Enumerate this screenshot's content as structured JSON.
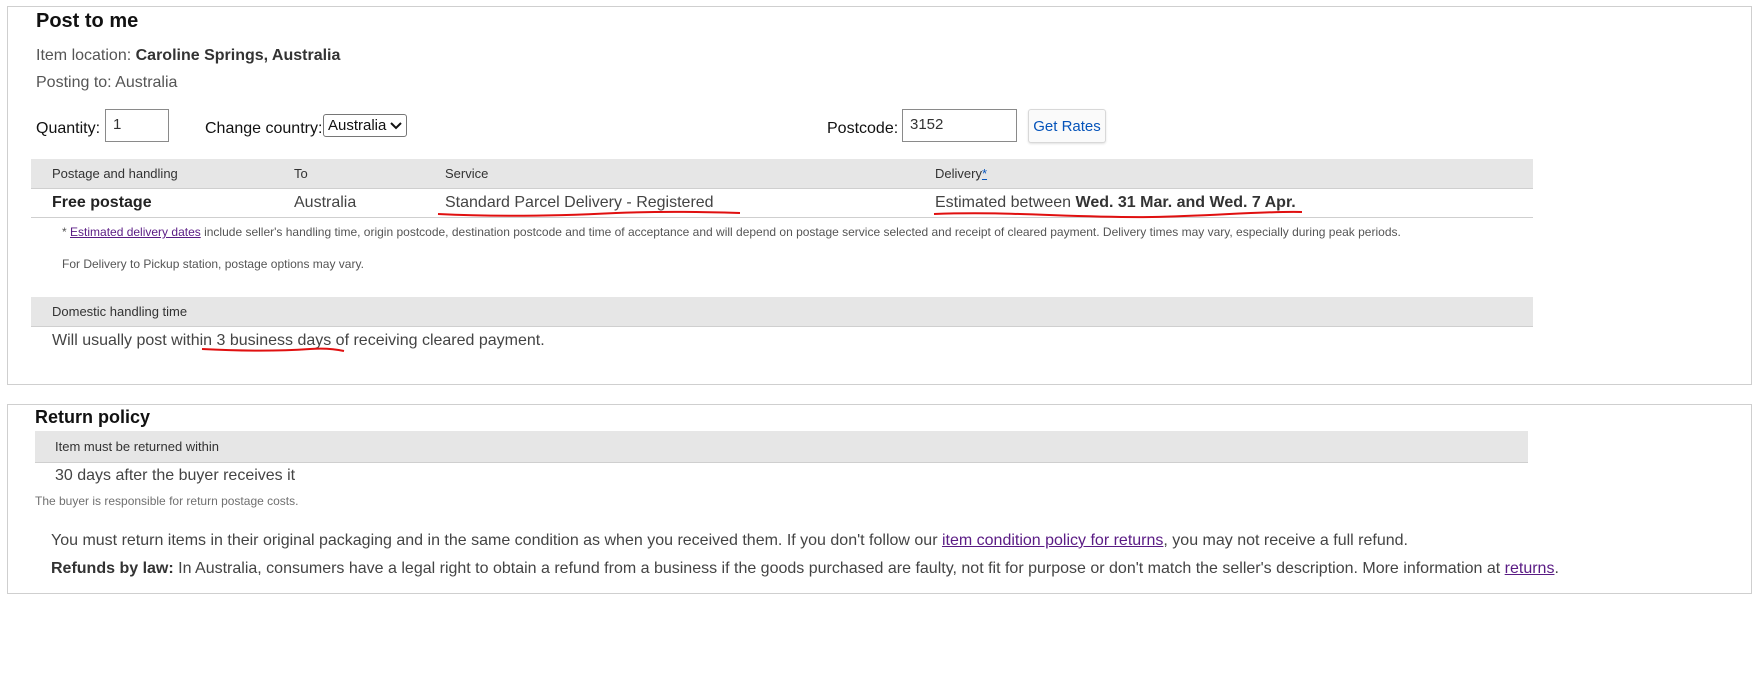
{
  "post_section": {
    "title": "Post to me",
    "item_location_label": "Item location:",
    "item_location_value": "Caroline Springs, Australia",
    "posting_to_label": "Posting to:",
    "posting_to_value": "Australia",
    "quantity_label": "Quantity:",
    "quantity_value": "1",
    "change_country_label": "Change country:",
    "country_selected": "Australia",
    "postcode_label": "Postcode:",
    "postcode_value": "3152",
    "get_rates_label": "Get Rates"
  },
  "postage_table": {
    "headers": {
      "postage": "Postage and handling",
      "to": "To",
      "service": "Service",
      "delivery": "Delivery",
      "delivery_marker": "*"
    },
    "row": {
      "postage": "Free postage",
      "to": "Australia",
      "service": "Standard Parcel Delivery - Registered",
      "delivery_prefix": "Estimated between ",
      "delivery_dates": "Wed. 31 Mar. and Wed. 7 Apr."
    },
    "footnote_asterisk": "*",
    "footnote_link": "Estimated delivery dates",
    "footnote_text": " include seller's handling time, origin postcode, destination postcode and time of acceptance and will depend on postage service selected and receipt of cleared payment. Delivery times may vary, especially during peak periods.",
    "pickup_note": "For Delivery to Pickup station, postage options may vary."
  },
  "handling": {
    "header": "Domestic handling time",
    "text_before": "Will usually post within ",
    "highlight": "3 business days",
    "text_after": " of receiving cleared payment."
  },
  "returns": {
    "title": "Return policy",
    "header": "Item must be returned within",
    "period": "30 days after the buyer receives it",
    "postage_note": "The buyer is responsible for return postage costs.",
    "policy_text_1": "You must return items in their original packaging and in the same condition as when you received them. If you don't follow our ",
    "policy_link": "item condition policy for returns",
    "policy_text_2": ", you may not receive a full refund.",
    "refunds_label": "Refunds by law:",
    "refunds_text": " In Australia, consumers have a legal right to obtain a refund from a business if the goods purchased are faulty, not fit for purpose or don't match the seller's description. More information at ",
    "refunds_link": "returns",
    "refunds_end": "."
  },
  "colors": {
    "annotation": "#e01010",
    "link": "#5a1b84",
    "button_text": "#0654ba",
    "header_bar": "#e6e6e6"
  }
}
